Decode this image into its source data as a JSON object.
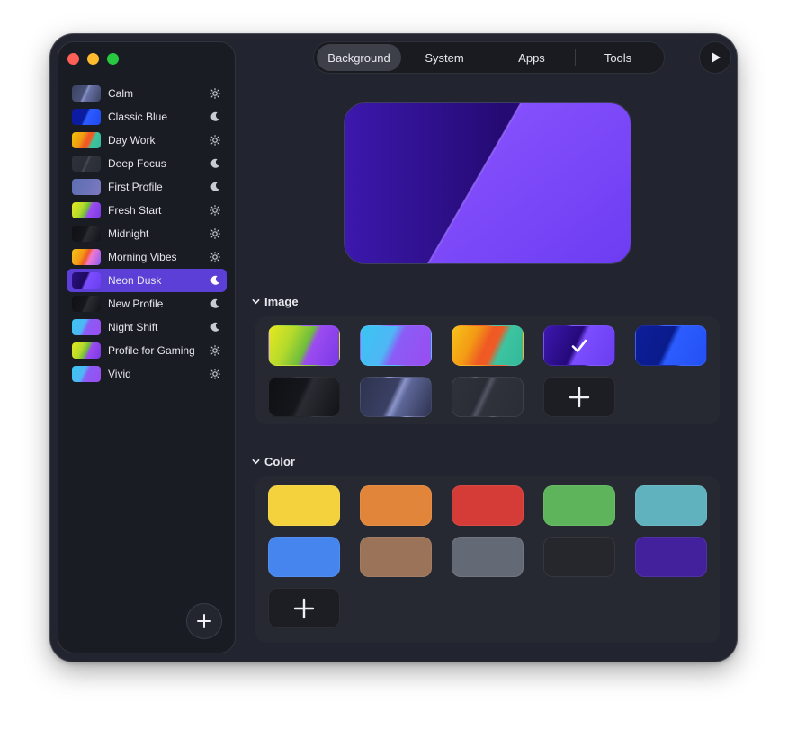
{
  "window": {
    "controls": [
      "close",
      "minimize",
      "zoom"
    ]
  },
  "sidebar": {
    "profiles": [
      {
        "label": "Calm",
        "mode": "light",
        "thumb": "linear-gradient(115deg,#3b4263 0%,#4a5278 42%,#8b94c8 48%,#6770a3 55%,#3b4263 100%)"
      },
      {
        "label": "Classic Blue",
        "mode": "dark",
        "thumb": "linear-gradient(115deg,#0e1aa8 0%,#0a1d9c 45%,#2c5cff 52%,#1f48f0 100%)"
      },
      {
        "label": "Day Work",
        "mode": "light",
        "thumb": "linear-gradient(115deg,#f5c400 0%,#f09a14 35%,#f15a24 50%,#f15a24 60%,#3cc4a0 70%,#34b89a 100%)"
      },
      {
        "label": "Deep Focus",
        "mode": "dark",
        "thumb": "linear-gradient(115deg,#2e313a 0%,#2a2d36 45%,#494c57 50%,#2f323b 56%,#2a2d36 100%)"
      },
      {
        "label": "First Profile",
        "mode": "dark",
        "thumb": "linear-gradient(115deg,#5e6fb2 0%,#6a73b8 50%,#7f79c0 100%)"
      },
      {
        "label": "Fresh Start",
        "mode": "light",
        "thumb": "linear-gradient(115deg,#e6e81e 0%,#b5da2c 35%,#6fbd3c 50%,#9b4cf0 60%,#7a38e6 100%)"
      },
      {
        "label": "Midnight",
        "mode": "light",
        "thumb": "linear-gradient(115deg,#0f1014 0%,#16171c 45%,#2a2c33 52%,#111216 100%)"
      },
      {
        "label": "Morning Vibes",
        "mode": "light",
        "thumb": "linear-gradient(115deg,#f7c21b 0%,#f39a14 35%,#ef5a24 50%,#f07ad0 62%,#8a5cf6 100%)"
      },
      {
        "label": "Neon Dusk",
        "mode": "dark",
        "thumb": "linear-gradient(115deg,#2b1186 0%,#1e0a5c 45%,#7b4dff 52%,#6a3ef0 100%)"
      },
      {
        "label": "New Profile",
        "mode": "dark",
        "thumb": "linear-gradient(115deg,#0f1014 0%,#16171c 45%,#2a2c33 52%,#111216 100%)"
      },
      {
        "label": "Night Shift",
        "mode": "dark",
        "thumb": "linear-gradient(115deg,#39c6f2 0%,#4fb6f5 40%,#8b5cf6 52%,#9a4cf0 100%)"
      },
      {
        "label": "Profile for Gaming",
        "mode": "light",
        "thumb": "linear-gradient(115deg,#e6e81e 0%,#b5da2c 35%,#6fbd3c 50%,#9b4cf0 60%,#7a38e6 100%)"
      },
      {
        "label": "Vivid",
        "mode": "light",
        "thumb": "linear-gradient(115deg,#39c6f2 0%,#4fb6f5 40%,#8b5cf6 52%,#9a4cf0 100%)"
      }
    ],
    "selected_profile": "Neon Dusk",
    "add_button_icon": "plus-icon"
  },
  "tabs": [
    {
      "label": "Background",
      "active": true
    },
    {
      "label": "System",
      "active": false
    },
    {
      "label": "Apps",
      "active": false
    },
    {
      "label": "Tools",
      "active": false
    }
  ],
  "play_icon": "play-icon",
  "sections": {
    "image": {
      "title": "Image"
    },
    "color": {
      "title": "Color"
    }
  },
  "image_swatches": [
    {
      "name": "lime-purple",
      "bg": "linear-gradient(115deg,#e6e81e 0%,#b5da2c 30%,#6fbd3c 52%,#9b4cf0 60%,#7a38e6 100%)",
      "selected": false
    },
    {
      "name": "cyan-purple",
      "bg": "linear-gradient(115deg,#39c6f2 0%,#4fb6f5 40%,#8b5cf6 52%,#9a4cf0 100%)",
      "selected": false
    },
    {
      "name": "sunset",
      "bg": "linear-gradient(115deg,#f7c21b 0%,#f39a14 30%,#ef5a24 48%,#f05a24 58%,#3cc4a0 68%,#34b89a 100%)",
      "selected": false
    },
    {
      "name": "neon-dusk",
      "bg": "linear-gradient(115deg,#3d18b0 0%,#25097a 45%,#7b4dff 52%,#6a3ef0 100%)",
      "selected": true
    },
    {
      "name": "classic-blue",
      "bg": "linear-gradient(115deg,#0d1d9a 0%,#0a1c8c 45%,#2c5cff 52%,#2350f2 100%)",
      "selected": false
    },
    {
      "name": "midnight",
      "bg": "linear-gradient(115deg,#0f1014 0%,#15161b 45%,#2a2c33 52%,#121317 100%)",
      "selected": false
    },
    {
      "name": "calm",
      "bg": "linear-gradient(115deg,#2e3350 0%,#3a4063 45%,#8b94c8 52%,#5c6596 60%,#2e3350 100%)",
      "selected": false
    },
    {
      "name": "deep-focus",
      "bg": "linear-gradient(115deg,#2f323b 0%,#2a2d36 40%,#535663 46%,#2f323b 52%,#2a2d36 100%)",
      "selected": false
    }
  ],
  "color_swatches": [
    {
      "name": "yellow",
      "hex": "#f4d23e"
    },
    {
      "name": "orange",
      "hex": "#e0853a"
    },
    {
      "name": "red",
      "hex": "#d53b37"
    },
    {
      "name": "green",
      "hex": "#5db45a"
    },
    {
      "name": "teal",
      "hex": "#60b2bf"
    },
    {
      "name": "blue",
      "hex": "#4684ee"
    },
    {
      "name": "brown",
      "hex": "#9a7358"
    },
    {
      "name": "gray",
      "hex": "#646a75"
    },
    {
      "name": "charcoal",
      "hex": "#25272c"
    },
    {
      "name": "indigo",
      "hex": "#43219d"
    }
  ],
  "colors": {
    "accent": "#5b3fd6",
    "window_bg": "#222530",
    "sidebar_bg": "#1a1c23"
  }
}
